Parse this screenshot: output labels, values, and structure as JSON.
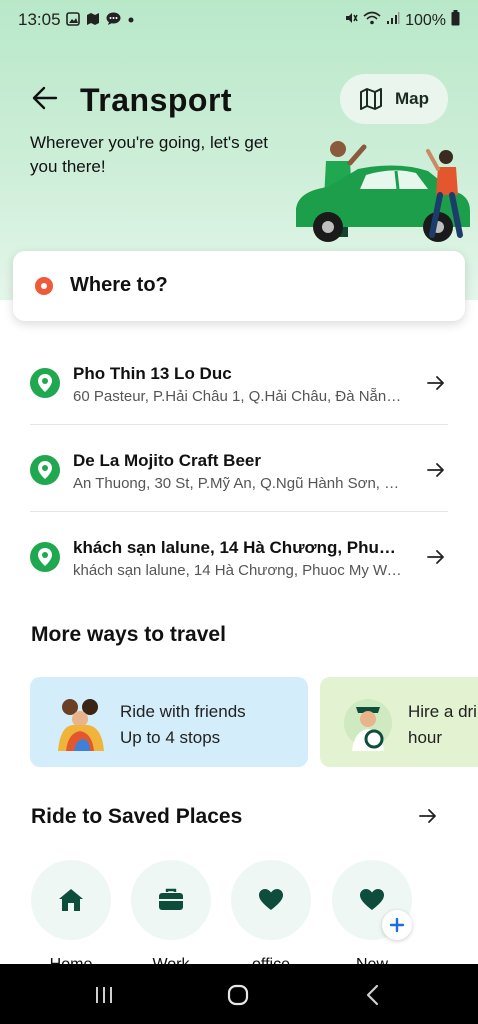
{
  "status_bar": {
    "time": "13:05",
    "battery": "100%"
  },
  "header": {
    "title": "Transport",
    "map_label": "Map",
    "subtitle": "Wherever you're going, let's get you there!"
  },
  "search": {
    "placeholder": "Where to?"
  },
  "recent_places": [
    {
      "name": "Pho Thin 13 Lo Duc",
      "address": "60 Pasteur, P.Hải Châu 1, Q.Hải Châu, Đà Nẵng, 5..."
    },
    {
      "name": "De La Mojito Craft Beer",
      "address": "An Thuong, 30 St, P.Mỹ An, Q.Ngũ Hành Sơn, Đà..."
    },
    {
      "name": "khách sạn lalune, 14 Hà Chương, Phuoc...",
      "address": "khách sạn lalune, 14 Hà Chương, Phuoc My War..."
    }
  ],
  "more_ways": {
    "title": "More ways to travel",
    "cards": [
      {
        "line1": "Ride with friends",
        "line2": "Up to 4 stops"
      },
      {
        "line1": "Hire a dri",
        "line2": "hour"
      }
    ]
  },
  "saved_places": {
    "title": "Ride to Saved Places",
    "items": [
      {
        "label": "Home",
        "icon": "home-icon"
      },
      {
        "label": "Work",
        "icon": "briefcase-icon"
      },
      {
        "label": "office",
        "icon": "heart-icon"
      },
      {
        "label": "New",
        "icon": "heart-icon"
      }
    ]
  },
  "colors": {
    "brand_green": "#1fa84f",
    "dark_green": "#0e4d3b",
    "origin_dot": "#ee5a3a",
    "header_bg": "#b9e8c9"
  }
}
